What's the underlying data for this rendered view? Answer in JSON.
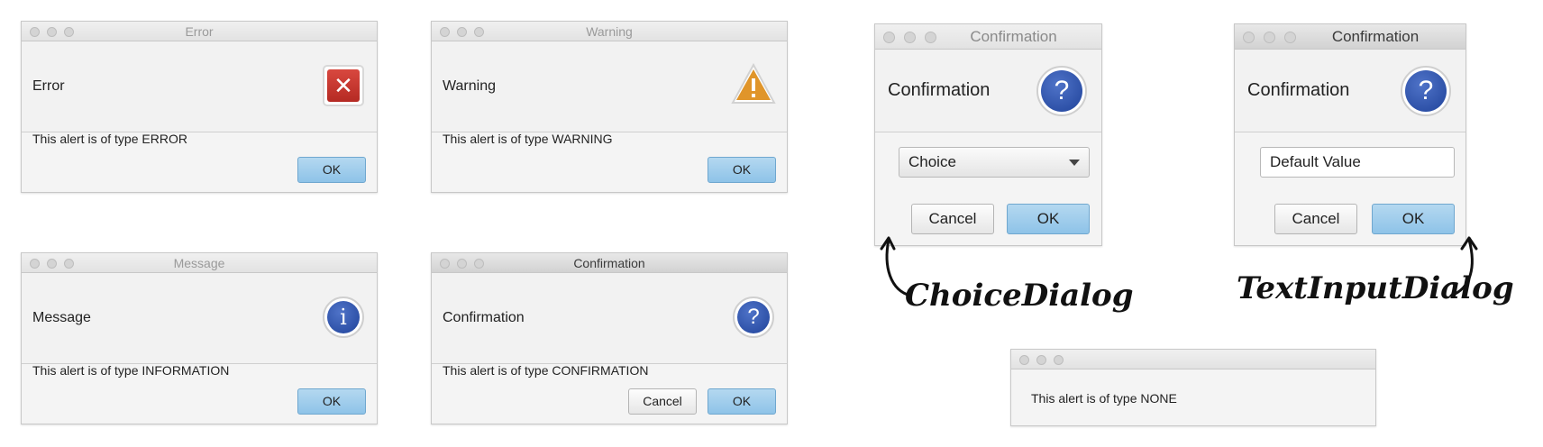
{
  "error_dialog": {
    "title": "Error",
    "header": "Error",
    "icon": "error-icon",
    "content": "This alert is of type ERROR",
    "ok_label": "OK"
  },
  "warning_dialog": {
    "title": "Warning",
    "header": "Warning",
    "icon": "warning-icon",
    "content": "This alert is of type WARNING",
    "ok_label": "OK"
  },
  "message_dialog": {
    "title": "Message",
    "header": "Message",
    "icon": "information-icon",
    "icon_glyph": "i",
    "content": "This alert is of type INFORMATION",
    "ok_label": "OK"
  },
  "confirmation_dialog": {
    "title": "Confirmation",
    "header": "Confirmation",
    "icon": "question-icon",
    "icon_glyph": "?",
    "content": "This alert is of type CONFIRMATION",
    "cancel_label": "Cancel",
    "ok_label": "OK"
  },
  "choice_dialog": {
    "title": "Confirmation",
    "header": "Confirmation",
    "icon_glyph": "?",
    "selected_choice": "Choice",
    "cancel_label": "Cancel",
    "ok_label": "OK",
    "annotation": "ChoiceDialog"
  },
  "text_input_dialog": {
    "title": "Confirmation",
    "header": "Confirmation",
    "icon_glyph": "?",
    "input_value": "Default Value",
    "cancel_label": "Cancel",
    "ok_label": "OK",
    "annotation": "TextInputDialog"
  },
  "none_dialog": {
    "title": "",
    "content": "This alert is of type NONE"
  },
  "colors": {
    "default_button": "#9ccbeb",
    "error_red": "#c8362f",
    "warning_orange": "#e0952a",
    "info_blue": "#2c4fa8"
  }
}
